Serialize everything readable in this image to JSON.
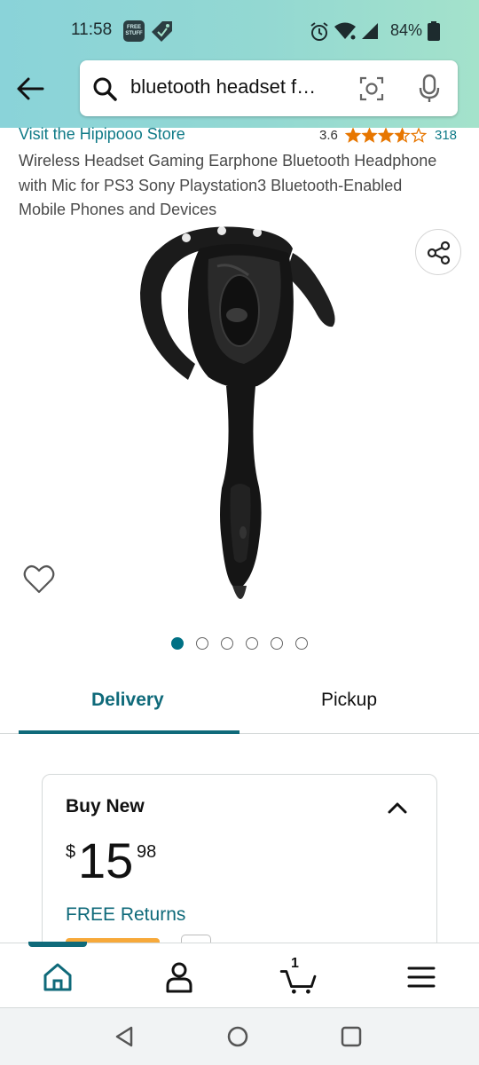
{
  "status_bar": {
    "time": "11:58",
    "free_badge_line1": "FREE",
    "free_badge_line2": "STUFF",
    "battery": "84%"
  },
  "search": {
    "query": "bluetooth headset f…"
  },
  "product": {
    "store_link": "Visit the Hipipooo Store",
    "rating": "3.6",
    "rating_stars_fraction": 0.72,
    "rating_count": "318",
    "title": "Wireless Headset Gaming Earphone Bluetooth Headphone with Mic for PS3 Sony Playstation3 Bluetooth-Enabled Mobile Phones and Devices",
    "image_count": 6,
    "active_image": 1
  },
  "tabs": {
    "delivery": "Delivery",
    "pickup": "Pickup"
  },
  "buy_box": {
    "title": "Buy New",
    "currency": "$",
    "price_whole": "15",
    "price_fraction": "98",
    "free_returns": "FREE Returns"
  },
  "bottom_nav": {
    "cart_count": "1"
  },
  "colors": {
    "header_gradient_start": "#8ad3d9",
    "header_gradient_end": "#a4e2cb",
    "link_teal": "#0f7a87",
    "star_orange": "#e77600",
    "accent_teal": "#0f6a7a"
  }
}
